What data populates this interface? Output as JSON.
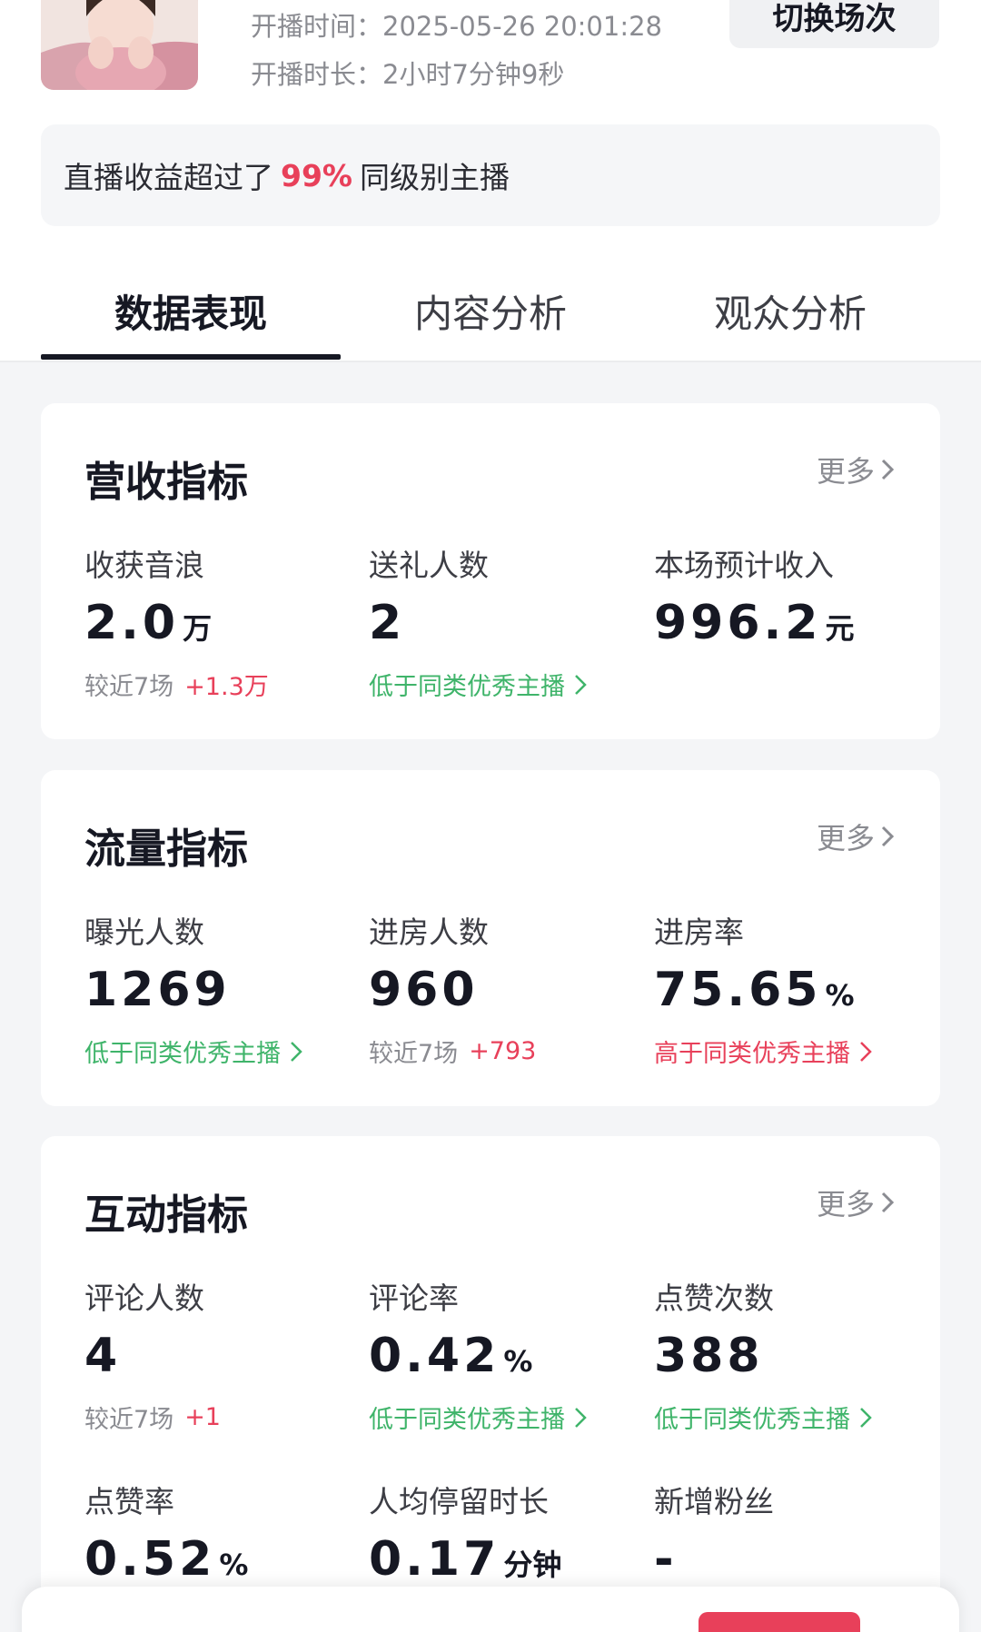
{
  "header": {
    "start_time": "开播时间：2025-05-26 20:01:28",
    "duration": "开播时长：2小时7分钟9秒",
    "switch_button": "切换场次"
  },
  "rank_banner": {
    "prefix": "直播收益超过了",
    "percent": "99%",
    "suffix": "同级别主播"
  },
  "tabs": [
    {
      "label": "数据表现",
      "active": true
    },
    {
      "label": "内容分析",
      "active": false
    },
    {
      "label": "观众分析",
      "active": false
    }
  ],
  "more_label": "更多",
  "revenue": {
    "title": "营收指标",
    "metrics": [
      {
        "label": "收获音浪",
        "value": "2.0",
        "unit": "万",
        "compare": "较近7场",
        "delta": "+1.3万"
      },
      {
        "label": "送礼人数",
        "value": "2",
        "unit": "",
        "benchmark": "低于同类优秀主播"
      },
      {
        "label": "本场预计收入",
        "value": "996.2",
        "unit": "元"
      }
    ]
  },
  "traffic": {
    "title": "流量指标",
    "metrics": [
      {
        "label": "曝光人数",
        "value": "1269",
        "unit": "",
        "benchmark": "低于同类优秀主播"
      },
      {
        "label": "进房人数",
        "value": "960",
        "unit": "",
        "compare": "较近7场",
        "delta": "+793"
      },
      {
        "label": "进房率",
        "value": "75.65",
        "unit": "%",
        "benchmark": "高于同类优秀主播"
      }
    ]
  },
  "interaction": {
    "title": "互动指标",
    "metrics": [
      {
        "label": "评论人数",
        "value": "4",
        "unit": "",
        "compare": "较近7场",
        "delta": "+1"
      },
      {
        "label": "评论率",
        "value": "0.42",
        "unit": "%",
        "benchmark": "低于同类优秀主播"
      },
      {
        "label": "点赞次数",
        "value": "388",
        "unit": "",
        "benchmark": "低于同类优秀主播"
      },
      {
        "label": "点赞率",
        "value": "0.52",
        "unit": "%"
      },
      {
        "label": "人均停留时长",
        "value": "0.17",
        "unit": "分钟"
      },
      {
        "label": "新增粉丝",
        "value": "-",
        "unit": ""
      }
    ]
  },
  "colors": {
    "accent_red": "#e8405a",
    "benchmark_green": "#3fb46a",
    "text_primary": "#161823",
    "text_muted": "#8a8b91"
  },
  "icons": [
    "chevron-right-icon",
    "avatar-photo"
  ]
}
